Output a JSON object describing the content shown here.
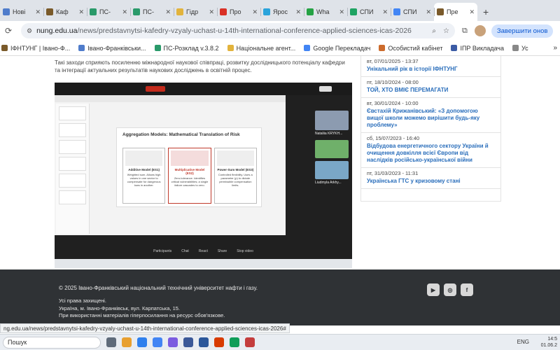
{
  "tabs": [
    {
      "label": "Нові",
      "color": "#4f7ccb"
    },
    {
      "label": "Каф",
      "color": "#7a5a2a"
    },
    {
      "label": "ПС-",
      "color": "#2a9a6a"
    },
    {
      "label": "ПС-",
      "color": "#2a9a6a"
    },
    {
      "label": "Гідр",
      "color": "#e2b33c"
    },
    {
      "label": "Про",
      "color": "#d93025"
    },
    {
      "label": "Ярос",
      "color": "#2aa3db"
    },
    {
      "label": "Wha",
      "color": "#25a244"
    },
    {
      "label": "СПИ",
      "color": "#1ea362"
    },
    {
      "label": "СПИ",
      "color": "#4285f4"
    },
    {
      "label": "Пре",
      "color": "#7a5a2a"
    }
  ],
  "address": {
    "site": "nung.edu.ua",
    "path": "/news/predstavnytsi-kafedry-vzyaly-uchast-u-14th-international-conference-applied-sciences-icas-2026",
    "finish_label": "Завершити онов"
  },
  "bookmarks": [
    {
      "label": "ІФНТУНГ | Івано-Ф...",
      "color": "#7a5a2a"
    },
    {
      "label": "Івано-Франківськи...",
      "color": "#4f7ccb"
    },
    {
      "label": "ПС-Розклад v.3.8.2",
      "color": "#2a9a6a"
    },
    {
      "label": "Національне агент...",
      "color": "#e2b33c"
    },
    {
      "label": "Google Перекладач",
      "color": "#4285f4"
    },
    {
      "label": "Особистий кабінет",
      "color": "#cc6b2c"
    },
    {
      "label": "ІПР Викладача",
      "color": "#3b5ba5"
    },
    {
      "label": "Ус",
      "color": "#888888"
    }
  ],
  "article": {
    "intro": "Такі заходи сприяють посиленню міжнародної наукової співпраці, розвитку дослідницького потенціалу кафедри та інтеграції актуальних результатів наукових досліджень в освітній процес."
  },
  "screenshot": {
    "slide_title": "Aggregation Models: Mathematical Translation of Risk",
    "models": [
      {
        "name": "Additive Model (ES1)",
        "desc": "Weighted sum. Allows high values in one sector to compensate for dangerous lows in another."
      },
      {
        "name": "Multiplicative Model (ES2)",
        "desc": "Zero-tolerance. Identifies critical vulnerabilities; a single failure cascades to zero."
      },
      {
        "name": "Power-Sum Model (ES3)",
        "desc": "Controlled flexibility. Uses a parameter (p) to dictate permissible compensation limits."
      }
    ],
    "participants": [
      "Nataliia KRYKH...",
      "Liudmyla Arkhy..."
    ],
    "controls": [
      "Participants",
      "Chat",
      "React",
      "Share",
      "Stop video"
    ]
  },
  "news": [
    {
      "date": "вт, 07/01/2025 - 13:37",
      "title": "Унікальний рік в історії ІФНТУНГ"
    },
    {
      "date": "пт, 18/10/2024 - 08:00",
      "title": "ТОЙ, ХТО ВМІЄ ПЕРЕМАГАТИ"
    },
    {
      "date": "вт, 30/01/2024 - 10:00",
      "title": "Євстахій Крижанівський: «З допомогою вищої школи можемо вирішити будь-яку проблему»"
    },
    {
      "date": "сб, 15/07/2023 - 16:40",
      "title": "Відбудова енергетичного сектору України й очищення довкілля всієї Європи від наслідків російсько-української війни"
    },
    {
      "date": "пт, 31/03/2023 - 11:31",
      "title": "Українська ГТС у кризовому стані"
    }
  ],
  "footer": {
    "copyright": "© 2025 Івано-Франківський національний технічний університет нафти і газу.",
    "rights": "Усі права захищені.",
    "address": "Україна, м. Івано-Франківськ, вул. Карпатська, 15.",
    "note": "При використанні матеріалів гіперпосилання на ресурс обов'язкове."
  },
  "status_url": "ng.edu.ua/news/predstavnytsi-kafedry-vzyaly-uchast-u-14th-international-conference-applied-sciences-icas-2026#",
  "taskbar": {
    "search": "Пошук",
    "lang": "ENG",
    "time": "14:5",
    "date": "01.06.2"
  }
}
